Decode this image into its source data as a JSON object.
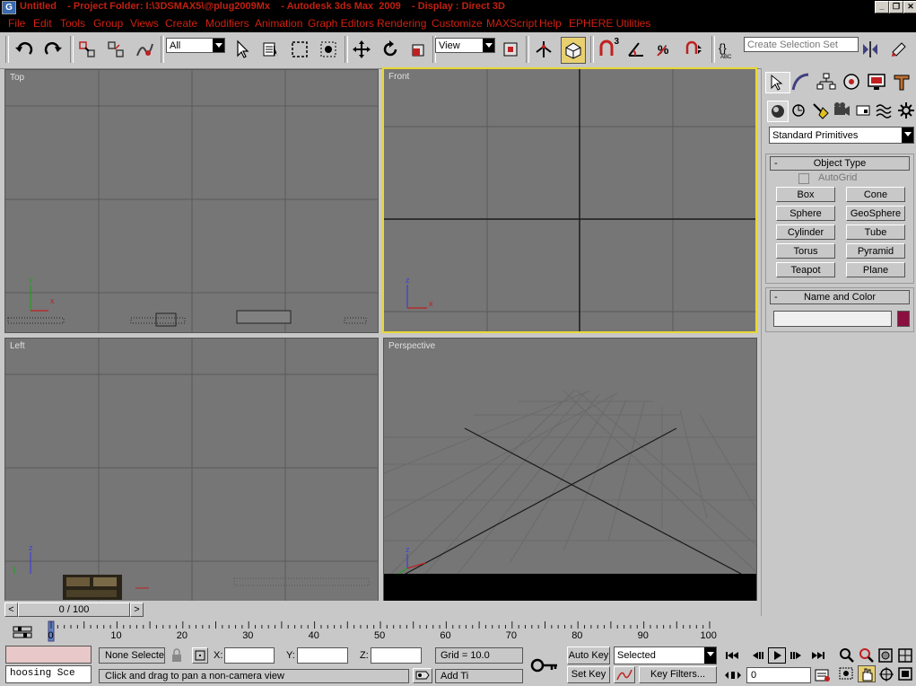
{
  "titlebar": {
    "title": "Untitled    - Project Folder: I:\\3DSMAX5\\@plug2009Mx    - Autodesk 3ds Max  2009    - Display : Direct 3D",
    "logo": "G"
  },
  "menu": [
    "File",
    "Edit",
    "Tools",
    "Group",
    "Views",
    "Create",
    "Modifiers",
    "Animation",
    "Graph Editors",
    "Rendering",
    "Customize",
    "MAXScript",
    "Help",
    "EPHERE Utilities"
  ],
  "toolbar": {
    "selection_filter": "All",
    "reference_coord": "View",
    "snap_label": "3",
    "named_selection_placeholder": "Create Selection Set"
  },
  "viewports": {
    "top": "Top",
    "front": "Front",
    "left": "Left",
    "perspective": "Perspective"
  },
  "command_panel": {
    "category": "Standard Primitives",
    "object_type_title": "Object Type",
    "autogrid": "AutoGrid",
    "buttons": [
      "Box",
      "Cone",
      "Sphere",
      "GeoSphere",
      "Cylinder",
      "Tube",
      "Torus",
      "Pyramid",
      "Teapot",
      "Plane"
    ],
    "name_color_title": "Name and Color",
    "object_color": "#8a1040"
  },
  "timeline": {
    "slider_label": "0 / 100",
    "prev": "<",
    "next": ">",
    "ticks": [
      "0",
      "10",
      "20",
      "30",
      "40",
      "50",
      "60",
      "70",
      "80",
      "90",
      "100"
    ]
  },
  "status": {
    "maxscript_text": "hoosing Sce",
    "selection": "None Selecte",
    "x_label": "X:",
    "y_label": "Y:",
    "z_label": "Z:",
    "grid": "Grid = 10.0",
    "prompt": "Click and drag to pan a non-camera view",
    "add_time": "Add Ti",
    "auto_key": "Auto Key",
    "set_key": "Set Key",
    "key_mode": "Selected",
    "key_filters": "Key Filters...",
    "frame": "0"
  },
  "axis_labels": {
    "x": "x",
    "y": "y",
    "z": "z"
  },
  "colors": {
    "active_viewport": "#e8d830",
    "menu_text": "#d02010",
    "viewport_bg": "#767676"
  }
}
